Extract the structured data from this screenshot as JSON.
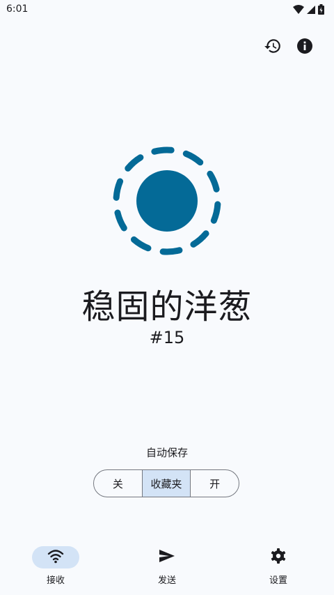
{
  "status_bar": {
    "time": "6:01"
  },
  "top_actions": {
    "history_icon": "history-icon",
    "info_icon": "info-icon"
  },
  "indicator": {
    "color": "#046a97"
  },
  "device": {
    "name": "稳固的洋葱",
    "number": "#15"
  },
  "autosave": {
    "label": "自动保存",
    "options": [
      "关",
      "收藏夹",
      "开"
    ],
    "selected": "收藏夹"
  },
  "bottom_nav": {
    "items": [
      {
        "label": "接收",
        "icon": "wifi-icon",
        "active": true
      },
      {
        "label": "发送",
        "icon": "send-icon",
        "active": false
      },
      {
        "label": "设置",
        "icon": "gear-icon",
        "active": false
      }
    ]
  },
  "colors": {
    "background": "#f8fafd",
    "accent": "#046a97",
    "selected_bg": "#d3e3f6",
    "outline": "#74777f"
  }
}
